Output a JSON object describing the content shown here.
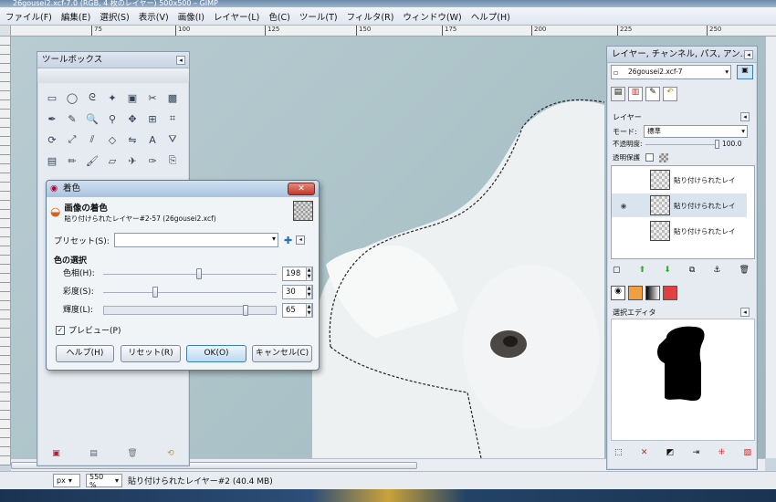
{
  "window": {
    "title": "26gousei2.xcf-7.0 (RGB, 4 枚のレイヤー) 500x500 – GIMP"
  },
  "menu": [
    "ファイル(F)",
    "編集(E)",
    "選択(S)",
    "表示(V)",
    "画像(I)",
    "レイヤー(L)",
    "色(C)",
    "ツール(T)",
    "フィルタ(R)",
    "ウィンドウ(W)",
    "ヘルプ(H)"
  ],
  "ruler": [
    "75",
    "100",
    "125",
    "150",
    "175",
    "200",
    "225",
    "250"
  ],
  "status": {
    "unit": "px",
    "zoom": "550 %",
    "info": "貼り付けられたレイヤー#2 (40.4 MB)"
  },
  "toolbox": {
    "title": "ツールボックス",
    "tools": [
      "rect-select-icon",
      "ellipse-select-icon",
      "lasso-icon",
      "fuzzy-select-icon",
      "color-select-icon",
      "scissors-icon",
      "foreground-select-icon",
      "paths-icon",
      "color-picker-icon",
      "zoom-icon",
      "measure-icon",
      "move-icon",
      "align-icon",
      "crop-icon",
      "rotate-icon",
      "scale-icon",
      "shear-icon",
      "perspective-icon",
      "flip-icon",
      "text-icon",
      "bucket-fill-icon",
      "blend-icon",
      "pencil-icon",
      "paintbrush-icon",
      "eraser-icon",
      "airbrush-icon",
      "ink-icon",
      "clone-icon"
    ],
    "tool_glyphs": [
      "▭",
      "◯",
      "ᘓ",
      "✦",
      "▣",
      "✂",
      "▩",
      "✒",
      "✎",
      "🔍",
      "⚲",
      "✥",
      "⊞",
      "⌗",
      "⟳",
      "⤢",
      "⫽",
      "◇",
      "⇋",
      "A",
      "⛛",
      "▤",
      "✏",
      "🖌",
      "▱",
      "✈",
      "✑",
      "⎘"
    ],
    "bottom_icons": [
      "save-icon",
      "restore-icon",
      "delete-icon",
      "reset-icon"
    ]
  },
  "dialog": {
    "title": "着色",
    "heading": "画像の着色",
    "subheading": "貼り付けられたレイヤー#2-57 (26gousei2.xcf)",
    "preset_label": "プリセット(S):",
    "section": "色の選択",
    "sliders": [
      {
        "label": "色相(H):",
        "value": "198",
        "fraction": 0.55
      },
      {
        "label": "彩度(S):",
        "value": "30",
        "fraction": 0.3
      },
      {
        "label": "輝度(L):",
        "value": "65",
        "fraction": 0.82
      }
    ],
    "preview_label": "プレビュー(P)",
    "buttons": {
      "help": "ヘルプ(H)",
      "reset": "リセット(R)",
      "ok": "OK(O)",
      "cancel": "キャンセル(C)"
    }
  },
  "layers_panel": {
    "title": "レイヤー, チャンネル, パス, アン...",
    "image_select": "26gousei2.xcf-7",
    "tab_label": "レイヤー",
    "mode_label": "モード:",
    "mode_value": "標準",
    "opacity_label": "不透明度:",
    "opacity_value": "100.0",
    "lock_label": "透明保護",
    "layers": [
      "貼り付けられたレイ",
      "貼り付けられたレイ",
      "貼り付けられたレイ"
    ],
    "selection_editor": "選択エディタ"
  },
  "colors": {
    "accent": "#3c7fb1",
    "canvas": "#aac2c7",
    "dog": "#f4f6f7"
  }
}
